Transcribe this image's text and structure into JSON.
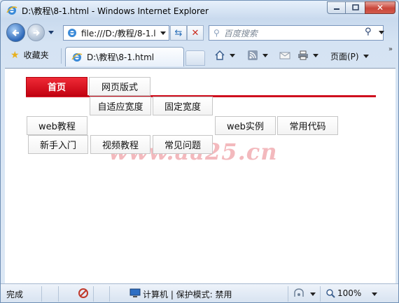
{
  "window": {
    "title": "D:\\教程\\8-1.html - Windows Internet Explorer",
    "minimize_label": "–",
    "maximize_label": "□",
    "close_label": "✕"
  },
  "address": {
    "url": "file:///D:/教程/8-1.l",
    "search_placeholder": "百度搜索"
  },
  "toolbar": {
    "favorites_label": "收藏夹",
    "tab_title": "D:\\教程\\8-1.html",
    "page_menu_label": "页面(P)"
  },
  "nav": {
    "row1": [
      "首页",
      "网页版式"
    ],
    "row2": [
      "自适应宽度",
      "固定宽度"
    ],
    "row3a": [
      "web教程"
    ],
    "row3b": [
      "web实例",
      "常用代码"
    ],
    "row4": [
      "新手入门",
      "视频教程",
      "常见问题"
    ]
  },
  "watermark": "www.aa25.cn",
  "status": {
    "left": "完成",
    "zone": "计算机 | 保护模式: 禁用",
    "zoom": "100%"
  },
  "colors": {
    "accent_red": "#cf0f1e",
    "watermark": "#f3b9bd"
  }
}
